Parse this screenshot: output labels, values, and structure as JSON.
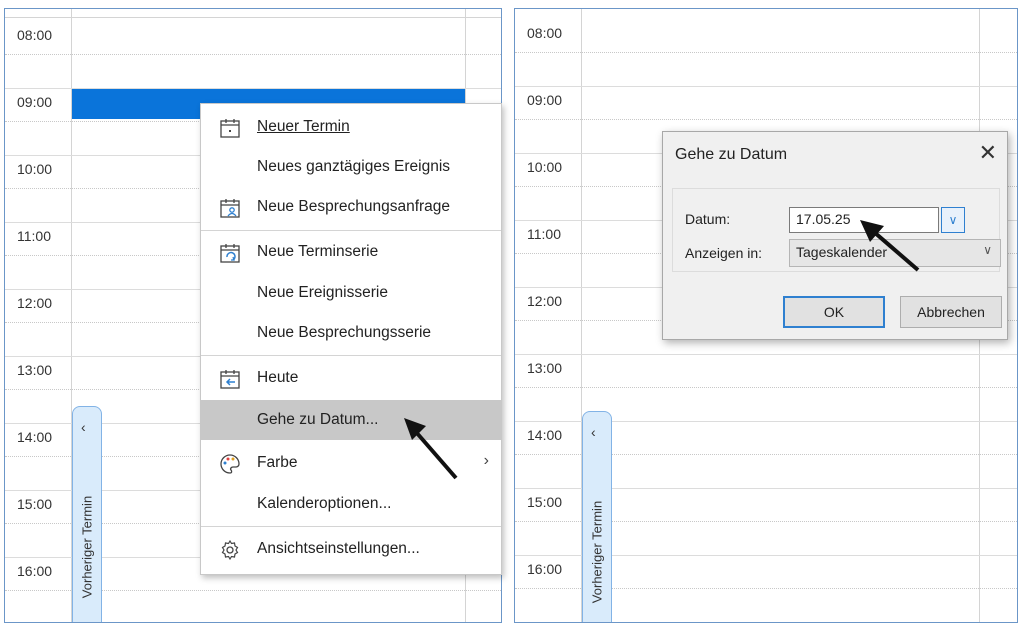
{
  "hours": [
    "08:00",
    "09:00",
    "10:00",
    "11:00",
    "12:00",
    "13:00",
    "14:00",
    "15:00",
    "16:00"
  ],
  "prev_tab": {
    "chevron": "‹",
    "label": "Vorheriger Termin"
  },
  "context_menu": {
    "items": [
      {
        "label": "Neuer Termin",
        "icon": "calendar-day-icon"
      },
      {
        "label": "Neues ganztägiges Ereignis",
        "icon": ""
      },
      {
        "label": "Neue Besprechungsanfrage",
        "icon": "meeting-request-icon"
      },
      {
        "label": "Neue Terminserie",
        "icon": "recurring-appointment-icon"
      },
      {
        "label": "Neue Ereignisserie",
        "icon": ""
      },
      {
        "label": "Neue Besprechungsserie",
        "icon": ""
      },
      {
        "label": "Heute",
        "icon": "today-calendar-icon"
      },
      {
        "label": "Gehe zu Datum...",
        "icon": ""
      },
      {
        "label": "Farbe",
        "icon": "color-palette-icon",
        "submenu": "›"
      },
      {
        "label": "Kalenderoptionen...",
        "icon": ""
      },
      {
        "label": "Ansichtseinstellungen...",
        "icon": "gear-icon"
      }
    ]
  },
  "dialog": {
    "title": "Gehe zu Datum",
    "close": "✕",
    "date_label": "Datum:",
    "date_value": "17.05.25",
    "show_in_label": "Anzeigen in:",
    "show_in_value": "Tageskalender",
    "ok_label": "OK",
    "cancel_label": "Abbrechen"
  },
  "colors": {
    "appointment": "#0a74da",
    "tab_bg": "#d9ebfb",
    "highlight": "#c8c8c8"
  }
}
